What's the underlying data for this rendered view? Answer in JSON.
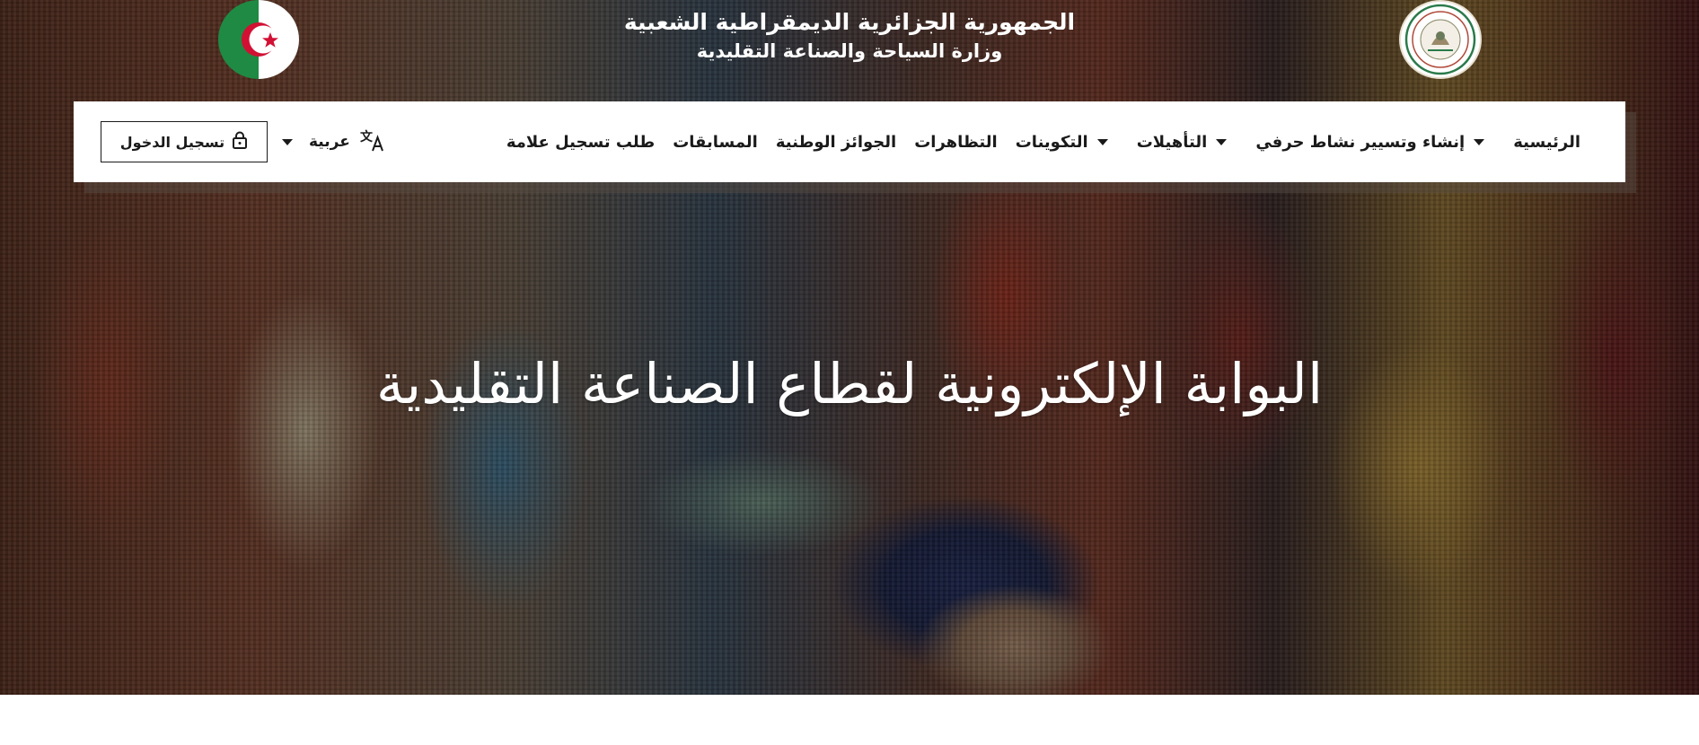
{
  "header": {
    "republic_title": "الجمهورية الجزائرية الديمقراطية الشعبية",
    "ministry_title": "وزارة السياحة والصناعة التقليدية",
    "flag_icon": "algeria-flag",
    "ministry_logo": "ministry-seal-logo"
  },
  "nav": {
    "items": [
      {
        "label": "الرئيسية",
        "has_dropdown": false
      },
      {
        "label": "إنشاء وتسيير نشاط حرفي",
        "has_dropdown": true
      },
      {
        "label": "التأهيلات",
        "has_dropdown": true
      },
      {
        "label": "التكوينات",
        "has_dropdown": true
      },
      {
        "label": "التظاهرات",
        "has_dropdown": false
      },
      {
        "label": "الجوائز الوطنية",
        "has_dropdown": false
      },
      {
        "label": "المسابقات",
        "has_dropdown": false
      },
      {
        "label": "طلب تسجيل علامة",
        "has_dropdown": false
      }
    ],
    "language_label": "عربية",
    "language_icon": "translate-icon",
    "login_label": "تسجيل الدخول",
    "login_icon": "lock-icon"
  },
  "hero": {
    "title": "البوابة الإلكترونية لقطاع الصناعة التقليدية"
  },
  "colors": {
    "text_dark": "#1a1a1a",
    "white": "#ffffff",
    "flag_green": "#1f8a43",
    "flag_red": "#d21034"
  }
}
